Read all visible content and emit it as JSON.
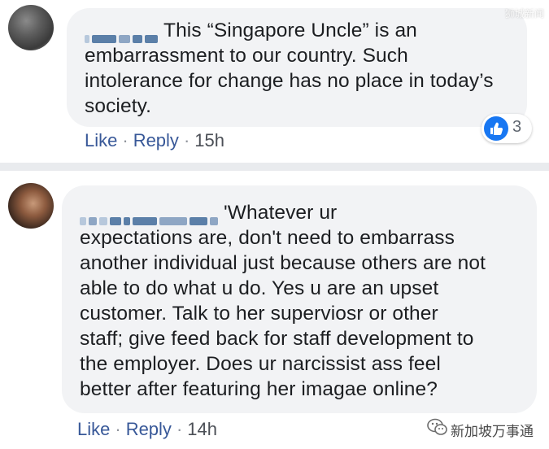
{
  "comments": [
    {
      "author": "",
      "text_lines": [
        "This “Singapore Uncle” is an",
        "embarrassment to our country. Such",
        "intolerance for change has no place in today’s",
        "society."
      ],
      "like_label": "Like",
      "reply_label": "Reply",
      "separator": "·",
      "timestamp": "15h",
      "reaction_icon": "thumbs-up-icon",
      "reaction_count": "3"
    },
    {
      "author": "",
      "text_lines": [
        "'Whatever ur",
        "expectations are, don't need to embarrass",
        "another individual just because others are not",
        "able to do what u do. Yes u are an upset",
        "customer. Talk to her superviosr or other",
        "staff; give feed back for staff development to",
        "the employer. Does ur narcissist ass feel",
        "better after featuring her imagae online?"
      ],
      "like_label": "Like",
      "reply_label": "Reply",
      "separator": "·",
      "timestamp": "14h"
    }
  ],
  "watermark": {
    "top_text": "狮城新闻",
    "bottom_text": "新加坡万事通",
    "bottom_icon": "wechat-logo-icon"
  },
  "colors": {
    "bubble_bg": "#f2f3f5",
    "link": "#385898",
    "like_blue": "#1877f2"
  }
}
